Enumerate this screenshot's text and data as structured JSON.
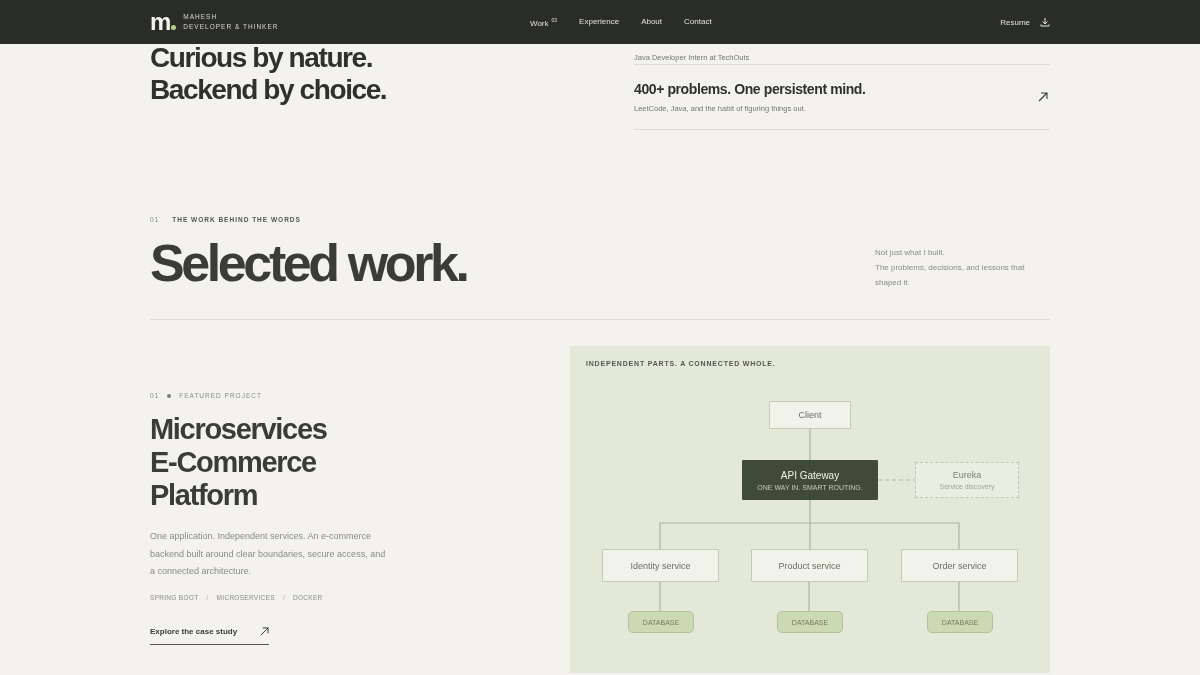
{
  "nav": {
    "logo": "m",
    "name": "MAHESH",
    "tagline": "DEVELOPER & THINKER",
    "links": [
      {
        "label": "Work",
        "count": "03"
      },
      {
        "label": "Experience"
      },
      {
        "label": "About"
      },
      {
        "label": "Contact"
      }
    ],
    "resume": "Resume"
  },
  "hero": {
    "lines": [
      "Curious by nature.",
      "Backend by choice."
    ],
    "highlights": [
      {
        "subtitle": "Java Developer Intern at TechOuts"
      },
      {
        "title": "400+ problems. One persistent mind.",
        "subtitle": "LeetCode, Java, and the habit of figuring things out."
      }
    ]
  },
  "section": {
    "number": "01",
    "eyebrow": "THE WORK BEHIND THE WORDS",
    "title": "Selected work.",
    "note": [
      "Not just what I built.",
      "The problems, decisions, and lessons that shaped it."
    ]
  },
  "project": {
    "number": "01",
    "label": "FEATURED PROJECT",
    "title": [
      "Microservices",
      "E-Commerce",
      "Platform"
    ],
    "description": "One application. Independent services. An e-commerce backend built around clear boundaries, secure access, and a connected architecture.",
    "tags": [
      "SPRING BOOT",
      "MICROSERVICES",
      "DOCKER"
    ],
    "tag_separator": "/",
    "link": "Explore the case study"
  },
  "diagram": {
    "caption": "INDEPENDENT PARTS. A CONNECTED WHOLE.",
    "client": "Client",
    "gateway": {
      "label": "API Gateway",
      "subtitle": "ONE WAY IN. SMART ROUTING."
    },
    "registry": {
      "label": "Eureka",
      "subtitle": "Service discovery"
    },
    "services": [
      {
        "label": "Identity service",
        "database": "DATABASE"
      },
      {
        "label": "Product service",
        "database": "DATABASE"
      },
      {
        "label": "Order service",
        "database": "DATABASE"
      }
    ]
  }
}
